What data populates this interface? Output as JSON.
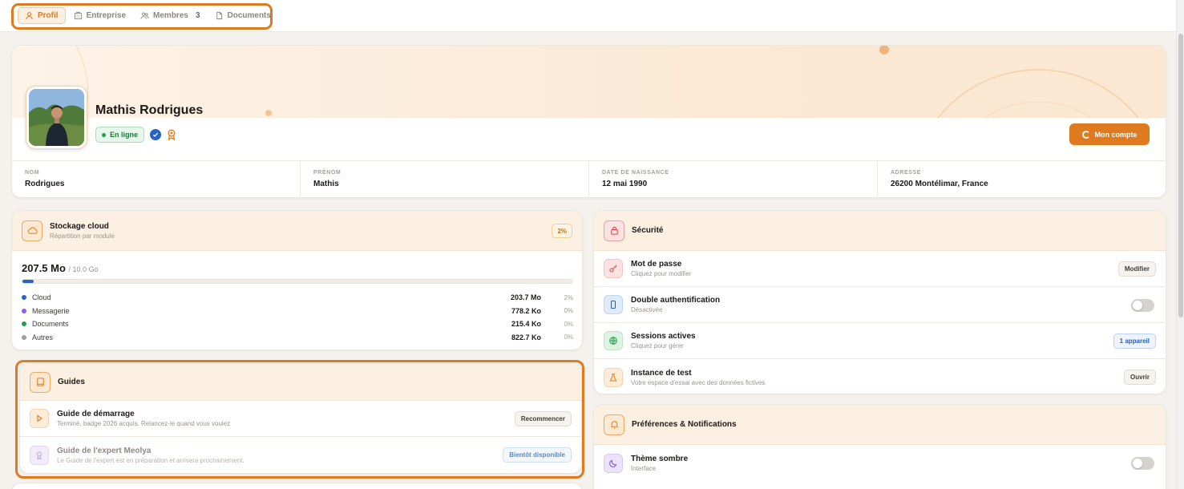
{
  "tabs": [
    {
      "label": "Profil",
      "icon": "user-icon"
    },
    {
      "label": "Entreprise",
      "icon": "building-icon"
    },
    {
      "label": "Membres",
      "count": "3",
      "icon": "users-icon"
    },
    {
      "label": "Documents",
      "icon": "document-icon"
    }
  ],
  "profile": {
    "name": "Mathis Rodrigues",
    "status": "En ligne",
    "account_button": "Mon compte",
    "fields": [
      {
        "label": "NOM",
        "value": "Rodrigues"
      },
      {
        "label": "PRÉNOM",
        "value": "Mathis"
      },
      {
        "label": "DATE DE NAISSANCE",
        "value": "12 mai 1990"
      },
      {
        "label": "ADRESSE",
        "value": "26200 Montélimar, France"
      }
    ]
  },
  "storage": {
    "title": "Stockage cloud",
    "subtitle": "Répartition par module",
    "percent_badge": "2%",
    "used": "207.5 Mo",
    "quota": "/ 10.0 Go",
    "used_fraction": 0.02,
    "items": [
      {
        "name": "Cloud",
        "size": "203.7 Mo",
        "pct": "2%",
        "color": "#2563c9"
      },
      {
        "name": "Messagerie",
        "size": "778.2 Ko",
        "pct": "0%",
        "color": "#8b5cf6"
      },
      {
        "name": "Documents",
        "size": "215.4 Ko",
        "pct": "0%",
        "color": "#22a046"
      },
      {
        "name": "Autres",
        "size": "822.7 Ko",
        "pct": "0%",
        "color": "#9aa0a6"
      }
    ]
  },
  "guides": {
    "title": "Guides",
    "items": [
      {
        "title": "Guide de démarrage",
        "subtitle": "Terminé, badge 2026 acquis. Relancez-le quand vous voulez",
        "button": "Recommencer"
      },
      {
        "title": "Guide de l'expert Meolya",
        "subtitle": "Le Guide de l'expert est en préparation et arrivera prochainement.",
        "button": "Bientôt disponible"
      }
    ]
  },
  "security": {
    "title": "Sécurité",
    "items": [
      {
        "title": "Mot de passe",
        "subtitle": "Cliquez pour modifier",
        "button": "Modifier"
      },
      {
        "title": "Double authentification",
        "subtitle": "Désactivée",
        "enabled": false
      },
      {
        "title": "Sessions actives",
        "subtitle": "Cliquez pour gérer",
        "button": "1 appareil"
      },
      {
        "title": "Instance de test",
        "subtitle": "Votre espace d'essai avec des données fictives",
        "button": "Ouvrir"
      }
    ]
  },
  "preferences": {
    "title": "Préférences & Notifications",
    "items": [
      {
        "title": "Thème sombre",
        "subtitle": "Interface",
        "enabled": false
      }
    ]
  },
  "colors": {
    "accent": "#e07a1f",
    "blue": "#2563c9"
  }
}
